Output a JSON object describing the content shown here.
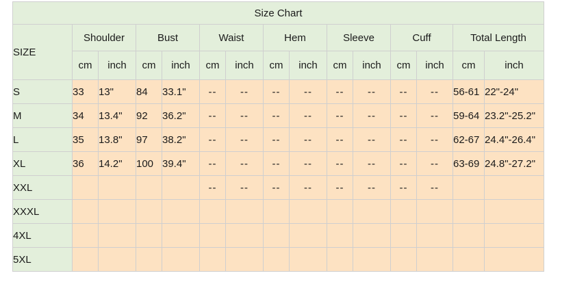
{
  "title": "Size Chart",
  "size_label": "SIZE",
  "groups": [
    "Shoulder",
    "Bust",
    "Waist",
    "Hem",
    "Sleeve",
    "Cuff",
    "Total Length"
  ],
  "units": [
    "cm",
    "inch",
    "cm",
    "inch",
    "cm",
    "inch",
    "cm",
    "inch",
    "cm",
    "inch",
    "cm",
    "inch",
    "cm",
    "inch"
  ],
  "rows": [
    {
      "size": "S",
      "cells": [
        "33",
        "13\"",
        "84",
        "33.1\"",
        "--",
        "--",
        "--",
        "--",
        "--",
        "--",
        "--",
        "--",
        "56-61",
        "22\"-24\""
      ]
    },
    {
      "size": "M",
      "cells": [
        "34",
        "13.4\"",
        "92",
        "36.2\"",
        "--",
        "--",
        "--",
        "--",
        "--",
        "--",
        "--",
        "--",
        "59-64",
        "23.2\"-25.2\""
      ]
    },
    {
      "size": "L",
      "cells": [
        "35",
        "13.8\"",
        "97",
        "38.2\"",
        "--",
        "--",
        "--",
        "--",
        "--",
        "--",
        "--",
        "--",
        "62-67",
        "24.4\"-26.4\""
      ]
    },
    {
      "size": "XL",
      "cells": [
        "36",
        "14.2\"",
        "100",
        "39.4\"",
        "--",
        "--",
        "--",
        "--",
        "--",
        "--",
        "--",
        "--",
        "63-69",
        "24.8\"-27.2\""
      ]
    },
    {
      "size": "XXL",
      "cells": [
        "",
        "",
        "",
        "",
        "--",
        "--",
        "--",
        "--",
        "--",
        "--",
        "--",
        "--",
        "",
        ""
      ]
    },
    {
      "size": "XXXL",
      "cells": [
        "",
        "",
        "",
        "",
        "",
        "",
        "",
        "",
        "",
        "",
        "",
        "",
        "",
        ""
      ]
    },
    {
      "size": "4XL",
      "cells": [
        "",
        "",
        "",
        "",
        "",
        "",
        "",
        "",
        "",
        "",
        "",
        "",
        "",
        ""
      ]
    },
    {
      "size": "5XL",
      "cells": [
        "",
        "",
        "",
        "",
        "",
        "",
        "",
        "",
        "",
        "",
        "",
        "",
        "",
        ""
      ]
    }
  ],
  "colors": {
    "header_bg": "#e3efdb",
    "body_bg": "#fde2c2",
    "border": "#cfcfcf"
  }
}
